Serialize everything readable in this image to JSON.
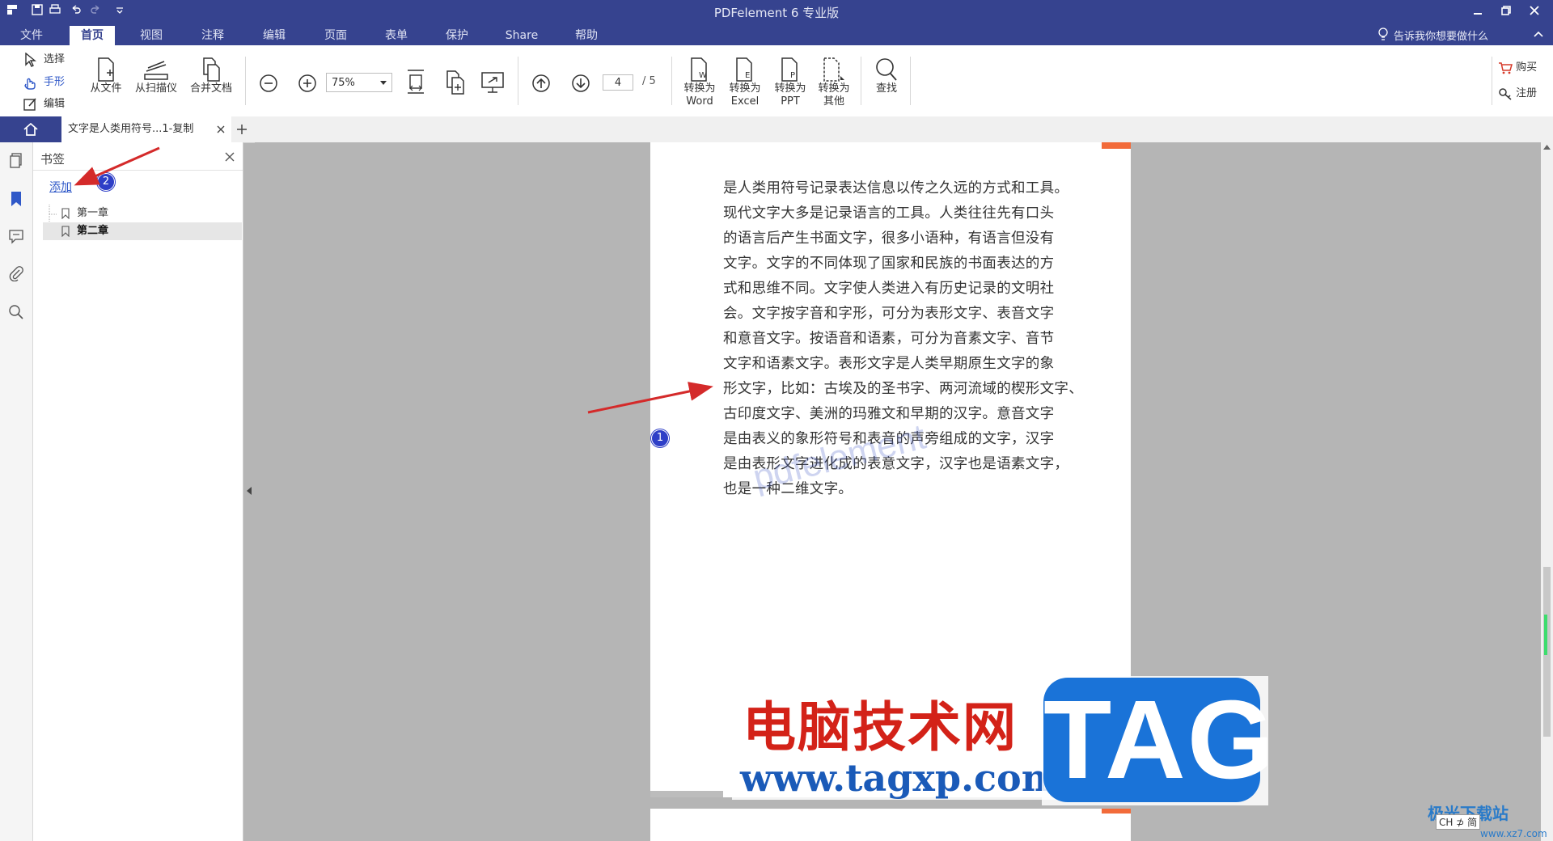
{
  "app": {
    "title": "PDFelement 6 专业版",
    "tell_me": "告诉我你想要做什么"
  },
  "menu": [
    "文件",
    "首页",
    "视图",
    "注释",
    "编辑",
    "页面",
    "表单",
    "保护",
    "Share",
    "帮助"
  ],
  "menu_active": "首页",
  "ribbon": {
    "modes": [
      "选择",
      "手形",
      "编辑"
    ],
    "create": [
      "从文件",
      "从扫描仪",
      "合并文档"
    ],
    "zoom": "75%",
    "page_current": "4",
    "page_total": "/ 5",
    "convert": [
      {
        "line1": "转换为",
        "line2": "Word"
      },
      {
        "line1": "转换为",
        "line2": "Excel"
      },
      {
        "line1": "转换为",
        "line2": "PPT"
      },
      {
        "line1": "转换为",
        "line2": "其他"
      }
    ],
    "find": "查找",
    "buy": "购买",
    "register": "注册"
  },
  "tabs": {
    "doc_title": "文字是人类用符号...1-复制"
  },
  "bookmarks": {
    "title": "书签",
    "add_label": "添加",
    "items": [
      "第一章",
      "第二章"
    ],
    "selected_index": 1
  },
  "document": {
    "lines": [
      "是人类用符号记录表达信息以传之久远的方式和工具。",
      "现代文字大多是记录语言的工具。人类往往先有口头",
      "的语言后产生书面文字，很多小语种，有语言但没有",
      "文字。文字的不同体现了国家和民族的书面表达的方",
      "式和思维不同。文字使人类进入有历史记录的文明社",
      "会。文字按字音和字形，可分为表形文字、表音文字",
      "和意音文字。按语音和语素，可分为音素文字、音节",
      "文字和语素文字。表形文字是人类早期原生文字的象",
      "形文字，比如：古埃及的圣书字、两河流域的楔形文字、",
      "古印度文字、美洲的玛雅文和早期的汉字。意音文字",
      "是由表义的象形符号和表音的声旁组成的文字，汉字",
      "是由表形文字进化成的表意文字，汉字也是语素文字，",
      "也是一种二维文字。"
    ],
    "watermark": "pdfelement"
  },
  "annotations": {
    "badge1": "1",
    "badge2": "2"
  },
  "overlay": {
    "site_name": "电脑技术网",
    "site_tag": "TAG",
    "site_url": "www.tagxp.com",
    "corner_logo": "极光下载站",
    "corner_url": "www.xz7.com",
    "ime": "CH ⊅ 简"
  },
  "colors": {
    "brand": "#36438f",
    "link": "#2f58c8",
    "arrow": "#d42a2a",
    "badge": "#2e3fc7"
  }
}
